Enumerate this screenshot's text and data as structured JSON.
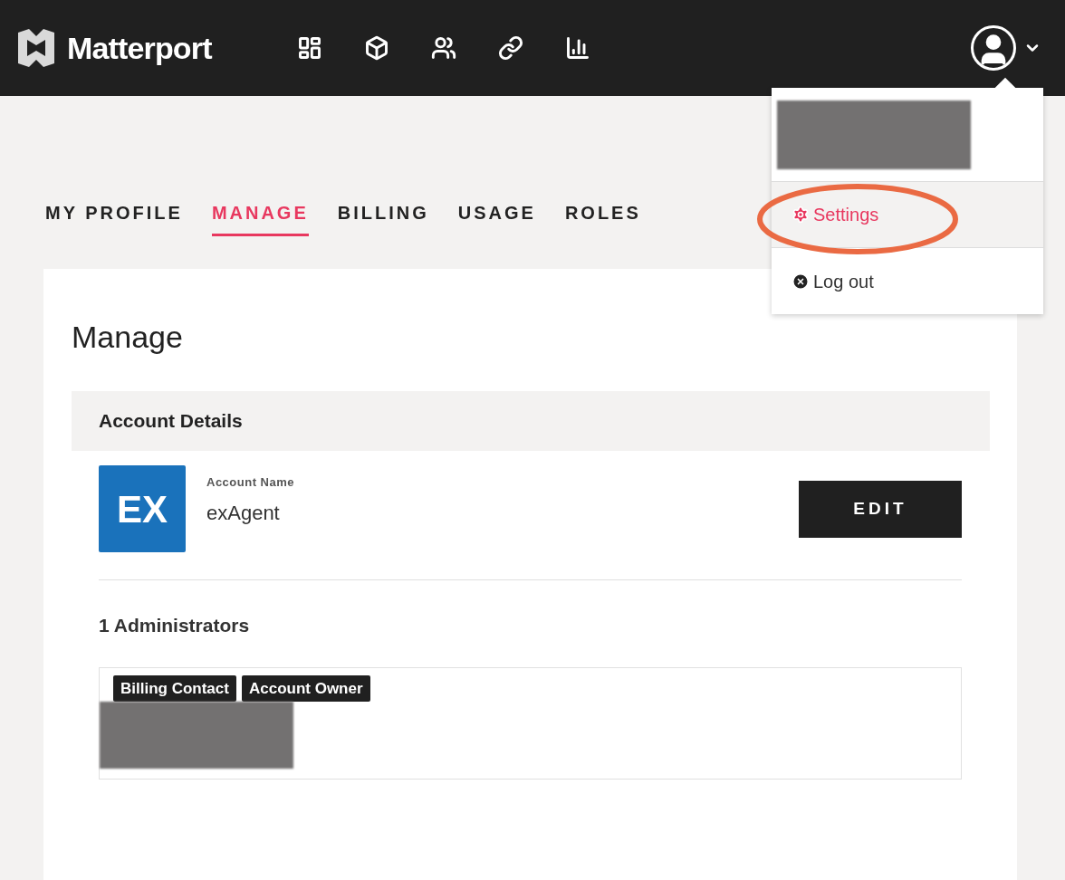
{
  "header": {
    "brand": "Matterport"
  },
  "user_menu": {
    "items": [
      {
        "kind": "settings",
        "label": "Settings",
        "selected": true
      },
      {
        "kind": "logout",
        "label": "Log out",
        "selected": false
      }
    ]
  },
  "tabs": [
    {
      "label": "MY PROFILE",
      "selected": false
    },
    {
      "label": "MANAGE",
      "selected": true
    },
    {
      "label": "BILLING",
      "selected": false
    },
    {
      "label": "USAGE",
      "selected": false
    },
    {
      "label": "ROLES",
      "selected": false
    }
  ],
  "card": {
    "title": "Manage",
    "section": {
      "title": "Account Details",
      "avatar": "EX",
      "field_label": "Account Name",
      "field_value": "exAgent",
      "button": "EDIT"
    },
    "admins": {
      "title": "1 Administrators",
      "badges": [
        "Billing Contact",
        "Account Owner"
      ]
    }
  }
}
